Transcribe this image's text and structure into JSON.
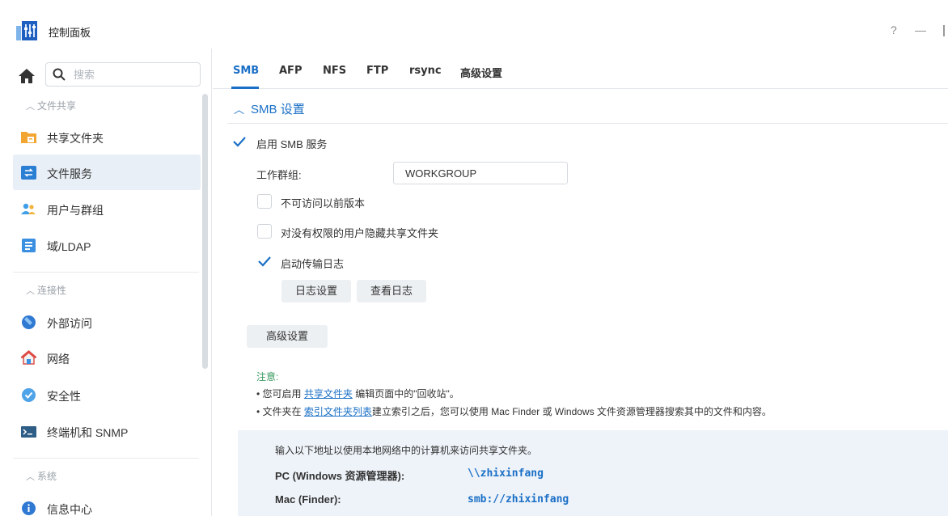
{
  "window": {
    "title": "控制面板",
    "help_label": "?",
    "minimize_label": "—"
  },
  "sidebar": {
    "search_placeholder": "搜索",
    "sections": [
      {
        "label": "文件共享"
      },
      {
        "label": "连接性"
      },
      {
        "label": "系统"
      }
    ],
    "items": [
      {
        "label": "共享文件夹",
        "icon": "shared-folder-icon"
      },
      {
        "label": "文件服务",
        "icon": "file-services-icon",
        "active": true
      },
      {
        "label": "用户与群组",
        "icon": "users-groups-icon"
      },
      {
        "label": "域/LDAP",
        "icon": "domain-ldap-icon"
      },
      {
        "label": "外部访问",
        "icon": "external-access-icon"
      },
      {
        "label": "网络",
        "icon": "network-icon"
      },
      {
        "label": "安全性",
        "icon": "security-shield-icon"
      },
      {
        "label": "终端机和 SNMP",
        "icon": "terminal-icon"
      },
      {
        "label": "信息中心",
        "icon": "info-center-icon"
      }
    ]
  },
  "tabs": [
    {
      "label": "SMB",
      "active": true
    },
    {
      "label": "AFP"
    },
    {
      "label": "NFS"
    },
    {
      "label": "FTP"
    },
    {
      "label": "rsync"
    },
    {
      "label": "高级设置"
    }
  ],
  "smb": {
    "section_title": "SMB 设置",
    "enable_label": "启用 SMB 服务",
    "enable_checked": true,
    "workgroup_label": "工作群组:",
    "workgroup_value": "WORKGROUP",
    "prev_versions_label": "不可访问以前版本",
    "prev_versions_checked": false,
    "hide_shares_label": "对没有权限的用户隐藏共享文件夹",
    "hide_shares_checked": false,
    "transfer_log_label": "启动传输日志",
    "transfer_log_checked": true,
    "log_settings_button": "日志设置",
    "view_logs_button": "查看日志",
    "advanced_button": "高级设置"
  },
  "notes": {
    "title": "注意:",
    "line1_prefix": "• 您可启用 ",
    "line1_link": "共享文件夹",
    "line1_suffix": " 编辑页面中的\"回收站\"。",
    "line2_prefix": "• 文件夹在 ",
    "line2_link": "索引文件夹列表",
    "line2_suffix": "建立索引之后，您可以使用 Mac Finder 或 Windows 文件资源管理器搜索其中的文件和内容。"
  },
  "access": {
    "intro": "输入以下地址以使用本地网络中的计算机来访问共享文件夹。",
    "pc_label": "PC (Windows 资源管理器):",
    "pc_value": "\\\\zhixinfang",
    "mac_label": "Mac (Finder):",
    "mac_value": "smb://zhixinfang"
  },
  "colors": {
    "accent": "#1a6fc6",
    "note_green": "#3a9b60",
    "active_bg": "#e9eff6"
  }
}
